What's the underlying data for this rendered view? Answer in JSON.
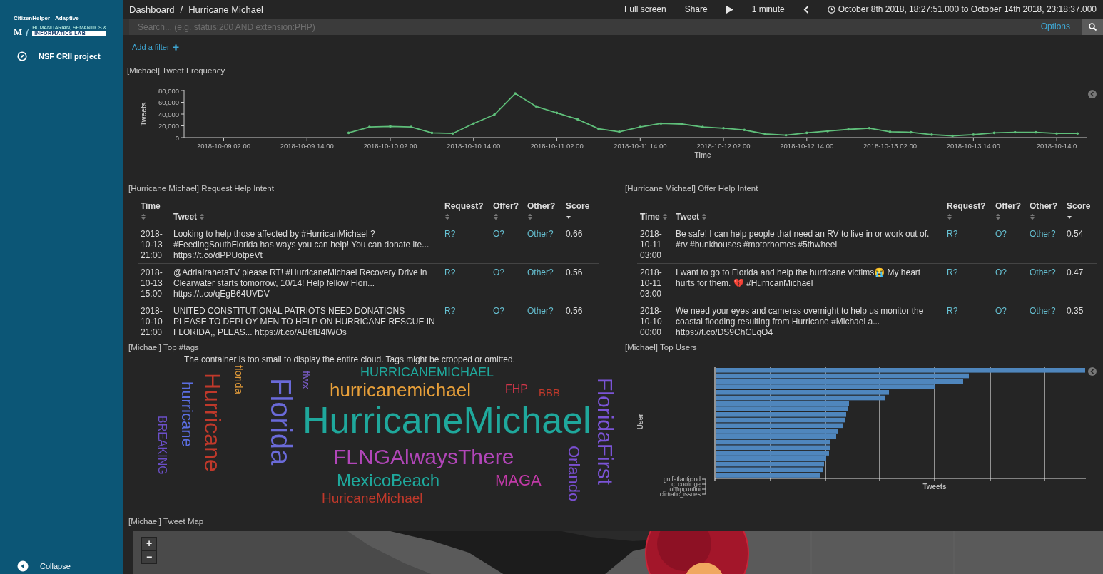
{
  "sidebar": {
    "logo": {
      "title": "CitizenHelper - Adaptive",
      "letter": "M",
      "subtitle": "HUMANITARIAN, SEMANTICS &",
      "lab": "INFORMATICS LAB"
    },
    "items": [
      {
        "label": "NSF CRII project"
      }
    ],
    "collapse": "Collapse"
  },
  "breadcrumb": {
    "parent": "Dashboard",
    "separator": "/",
    "current": "Hurricane Michael"
  },
  "top_menu": {
    "full_screen": "Full screen",
    "share": "Share",
    "interval": "1 minute",
    "time_range": "October 8th 2018, 18:27:51.000 to October 14th 2018, 23:18:37.000"
  },
  "search": {
    "placeholder": "Search... (e.g. status:200 AND extension:PHP)",
    "options": "Options"
  },
  "filter": {
    "add": "Add a filter"
  },
  "frequency": {
    "title": "[Michael] Tweet Frequency",
    "chart_data": {
      "type": "line",
      "xlabel": "Time",
      "ylabel": "Tweets",
      "categories": [
        "2018-10-09 02:00",
        null,
        null,
        null,
        "2018-10-09 14:00",
        null,
        null,
        null,
        "2018-10-10 02:00",
        null,
        null,
        null,
        "2018-10-10 14:00",
        null,
        null,
        null,
        "2018-10-11 02:00",
        null,
        null,
        null,
        "2018-10-11 14:00",
        null,
        null,
        null,
        "2018-10-12 02:00",
        null,
        null,
        null,
        "2018-10-12 14:00",
        null,
        null,
        null,
        "2018-10-13 02:00",
        null,
        null,
        null,
        "2018-10-13 14:00",
        null,
        null,
        null,
        "2018-10-14 0",
        null
      ],
      "series": [
        {
          "color": "#5fbf7a",
          "values": [
            null,
            null,
            null,
            null,
            null,
            null,
            8000,
            18000,
            19000,
            18000,
            8000,
            7000,
            24000,
            39000,
            75000,
            53000,
            42000,
            31000,
            15000,
            10000,
            18000,
            24000,
            23000,
            18000,
            16000,
            13000,
            6000,
            4000,
            8000,
            11000,
            14000,
            16000,
            10000,
            9000,
            5000,
            3000,
            5000,
            8000,
            9000,
            9000,
            7000,
            7000
          ]
        }
      ],
      "ylim": [
        0,
        80000
      ],
      "yticks": [
        {
          "value": 0,
          "label": "0"
        },
        {
          "value": 20000,
          "label": "20,000"
        },
        {
          "value": 40000,
          "label": "40,000"
        },
        {
          "value": 60000,
          "label": "60,000"
        },
        {
          "value": 80000,
          "label": "80,000"
        }
      ]
    }
  },
  "request_table": {
    "title": "[Hurricane Michael] Request Help Intent",
    "columns": [
      {
        "label": "Time",
        "sorted": false
      },
      {
        "label": "Tweet",
        "sorted": false
      },
      {
        "label": "Request?",
        "sorted": false
      },
      {
        "label": "Offer?",
        "sorted": false
      },
      {
        "label": "Other?",
        "sorted": false
      },
      {
        "label": "Score",
        "sorted": true
      }
    ],
    "rows": [
      {
        "time": "2018-10-13 21:00",
        "tweet": "Looking to help those affected by #HurricanMichael ? #FeedingSouthFlorida has ways you can help! You can donate ite... https://t.co/dPPUotpeVt",
        "request": "R?",
        "offer": "O?",
        "other": "Other?",
        "score": "0.66"
      },
      {
        "time": "2018-10-13 15:00",
        "tweet": "@AdriaIrahetaTV please RT! #HurricaneMichael Recovery Drive in Clearwater starts tomorrow, 10/14! Help fellow Flori... https://t.co/qEgB64UVDV",
        "request": "R?",
        "offer": "O?",
        "other": "Other?",
        "score": "0.56"
      },
      {
        "time": "2018-10-10 21:00",
        "tweet": "UNITED CONSTITUTIONAL PATRIOTS NEED DONATIONS PLEASE TO DEPLOY MEN TO HELP ON HURRICANE RESCUE IN FLORIDA,, PLEAS... https://t.co/AB6fB4lWOs",
        "request": "R?",
        "offer": "O?",
        "other": "Other?",
        "score": "0.56"
      }
    ]
  },
  "offer_table": {
    "title": "[Hurricane Michael] Offer Help Intent",
    "columns": [
      {
        "label": "Time",
        "sorted": false
      },
      {
        "label": "Tweet",
        "sorted": false
      },
      {
        "label": "Request?",
        "sorted": false
      },
      {
        "label": "Offer?",
        "sorted": false
      },
      {
        "label": "Other?",
        "sorted": false
      },
      {
        "label": "Score",
        "sorted": true
      }
    ],
    "rows": [
      {
        "time": "2018-10-11 03:00",
        "tweet": "Be safe! I can help people that need an RV to live in or work out of. #rv #bunkhouses #motorhomes #5thwheel",
        "request": "R?",
        "offer": "O?",
        "other": "Other?",
        "score": "0.54"
      },
      {
        "time": "2018-10-11 03:00",
        "tweet": "I want to go to Florida and help the hurricane victims😭 My heart hurts for them. 💔 #HurricanMichael",
        "request": "R?",
        "offer": "O?",
        "other": "Other?",
        "score": "0.47"
      },
      {
        "time": "2018-10-10 00:00",
        "tweet": "We need your eyes and cameras overnight to help us monitor the coastal flooding resulting from Hurricane #Michael a... https://t.co/DS9ChGLqO4",
        "request": "R?",
        "offer": "O?",
        "other": "Other?",
        "score": "0.35"
      }
    ]
  },
  "top_tags": {
    "title": "[Michael] Top #tags",
    "notice": "The container is too small to display the entire cloud. Tags might be cropped or omitted.",
    "tags": [
      {
        "text": "HURRICANEMICHAEL",
        "color": "#1fa89c",
        "rotated": false
      },
      {
        "text": "hurricanemichael",
        "color": "#e8a03a",
        "rotated": false
      },
      {
        "text": "FHP",
        "color": "#d0364a",
        "rotated": false
      },
      {
        "text": "BBB",
        "color": "#c0392b",
        "rotated": false
      },
      {
        "text": "HurricaneMichael",
        "color": "#1fa89c",
        "rotated": false
      },
      {
        "text": "FLNGAlwaysThere",
        "color": "#b146b8",
        "rotated": false
      },
      {
        "text": "MexicoBeach",
        "color": "#1fa89c",
        "rotated": false
      },
      {
        "text": "MAGA",
        "color": "#c23aa8",
        "rotated": false
      },
      {
        "text": "HuricaneMichael",
        "color": "#c0392b",
        "rotated": false
      },
      {
        "text": "BREAKING",
        "color": "#6b4fc8",
        "rotated": true
      },
      {
        "text": "hurricane",
        "color": "#5b6ee1",
        "rotated": true
      },
      {
        "text": "Hurricane",
        "color": "#c0392b",
        "rotated": true
      },
      {
        "text": "florida",
        "color": "#e09a3a",
        "rotated": true
      },
      {
        "text": "Florida",
        "color": "#6a6ad8",
        "rotated": true
      },
      {
        "text": "flwx",
        "color": "#7a5cc8",
        "rotated": true
      },
      {
        "text": "Orlando",
        "color": "#7a4fd0",
        "rotated": true
      },
      {
        "text": "FloridaFirst",
        "color": "#7b54d6",
        "rotated": true
      }
    ]
  },
  "top_users": {
    "title": "[Michael] Top Users",
    "ylabel": "User",
    "xlabel": "Tweets",
    "users": [
      "gulfatlanticind",
      "c_coolidge",
      "johnpcontini",
      "climatic_issues"
    ]
  },
  "map": {
    "title": "[Michael] Tweet Map",
    "zoom_in": "+",
    "zoom_out": "−"
  }
}
